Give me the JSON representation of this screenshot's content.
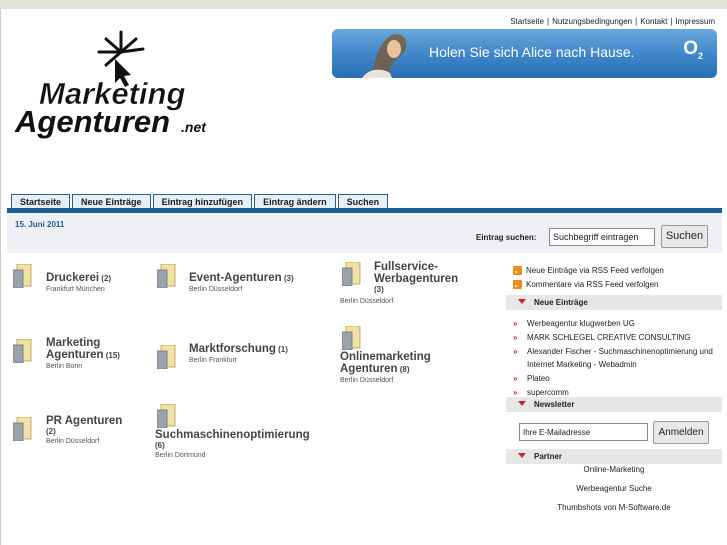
{
  "toplinks": {
    "startseite": "Startseite",
    "nutzung": "Nutzungsbedingungen",
    "kontakt": "Kontakt",
    "impressum": "Impressum",
    "sep": "|"
  },
  "logo": {
    "line1": "Marketing",
    "line2": "Agenturen",
    ".net": ".net"
  },
  "banner": {
    "text": "Holen Sie sich Alice nach Hause.",
    "brand": "O",
    "brand_sub": "2"
  },
  "tabs": [
    "Startseite",
    "Neue Einträge",
    "Eintrag hinzufügen",
    "Eintrag ändern",
    "Suchen"
  ],
  "date": "15. Juni 2011",
  "search": {
    "label": "Eintrag suchen:",
    "value": "Suchbegriff eintragen",
    "button": "Suchen"
  },
  "categories": [
    {
      "title": "Druckerei",
      "count": "(2)",
      "sub": "Frankfurt München"
    },
    {
      "title": "Event-Agenturen",
      "count": "(3)",
      "sub": "Berlin Düsseldorf"
    },
    {
      "title1": "Fullservice-",
      "title2": "Werbagenturen",
      "count": "(3)",
      "sub": "Berlin Düsseldorf"
    },
    {
      "title1": "Marketing",
      "title2": "Agenturen",
      "count": "(15)",
      "sub": "Berlin Bonn"
    },
    {
      "title": "Marktforschung",
      "count": "(1)",
      "sub": "Berlin Frankfurt"
    },
    {
      "title1": "Onlinemarketing",
      "title2": "Agenturen",
      "count": "(8)",
      "sub": "Berlin Düsseldorf"
    },
    {
      "title": "PR Agenturen",
      "count": "(2)",
      "sub": "Berlin Düsseldorf"
    },
    {
      "title": "Suchmaschinenoptimierung",
      "count": "(6)",
      "sub": "Berlin Dortmund"
    }
  ],
  "rss": [
    "Neue Einträge via RSS Feed verfolgen",
    "Kommentare via RSS Feed verfolgen"
  ],
  "sidebar": {
    "neue_heading": "Neue Einträge",
    "neue_items": [
      "Werbeagentur klugwerben UG",
      "MARK SCHLEGEL CREATIVE CONSULTING",
      "Alexander Fischer - Suchmaschinenoptimierung und Internet Marketing - Webadmin",
      "Plateo",
      "supercomm"
    ],
    "newsletter_heading": "Newsletter",
    "mail_value": "Ihre E-Mailadresse",
    "anmelden": "Anmelden",
    "partner_heading": "Partner",
    "partners": [
      "Online-Marketing",
      "Werbeagentur Suche",
      "Thumbshots von M-Software.de"
    ]
  }
}
